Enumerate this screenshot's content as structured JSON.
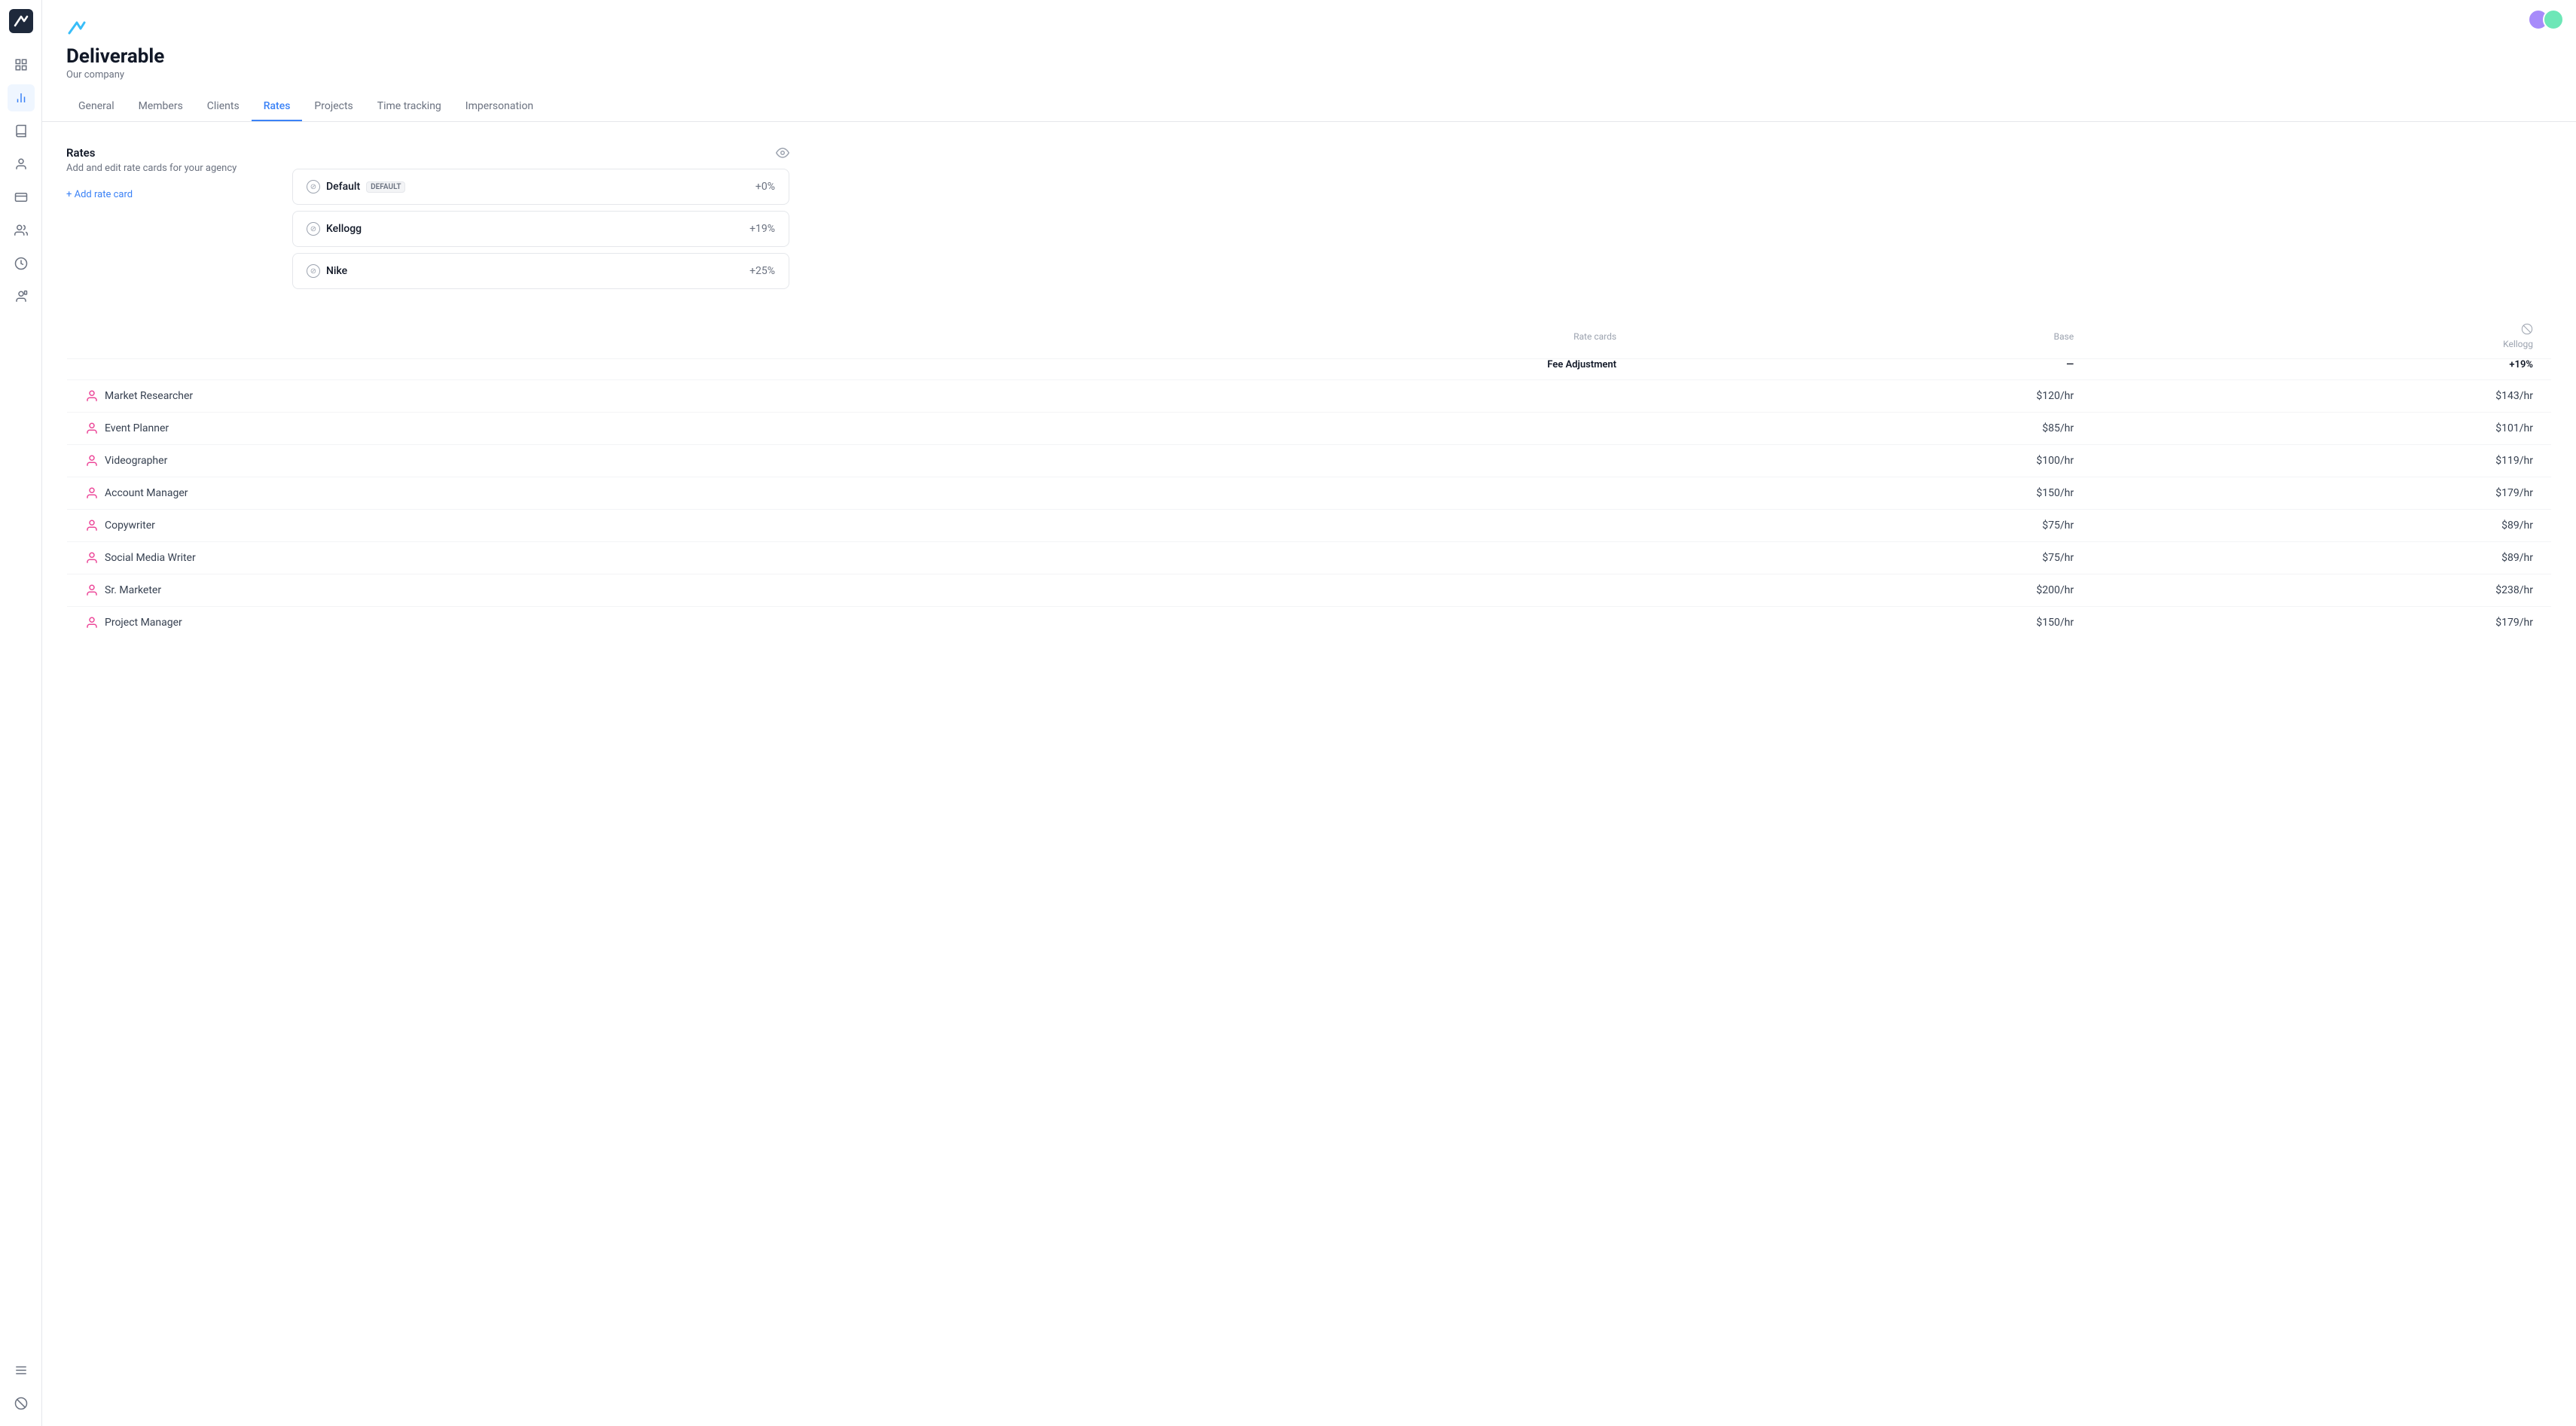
{
  "app": {
    "title": "Deliverable",
    "subtitle": "Our company"
  },
  "tabs": [
    {
      "id": "general",
      "label": "General"
    },
    {
      "id": "members",
      "label": "Members"
    },
    {
      "id": "clients",
      "label": "Clients"
    },
    {
      "id": "rates",
      "label": "Rates",
      "active": true
    },
    {
      "id": "projects",
      "label": "Projects"
    },
    {
      "id": "time-tracking",
      "label": "Time tracking"
    },
    {
      "id": "impersonation",
      "label": "Impersonation"
    }
  ],
  "rates_section": {
    "title": "Rates",
    "description": "Add and edit rate cards for your agency",
    "add_label": "+ Add rate card"
  },
  "rate_cards": [
    {
      "name": "Default",
      "badge": "DEFAULT",
      "pct": "+0%"
    },
    {
      "name": "Kellogg",
      "badge": null,
      "pct": "+19%"
    },
    {
      "name": "Nike",
      "badge": null,
      "pct": "+25%"
    }
  ],
  "table": {
    "col_rate_cards": "Rate cards",
    "col_fee": "Fee Adjustment",
    "col_base": "Base",
    "col_base_dash": "—",
    "col_kellogg": "Kellogg",
    "col_kellogg_pct": "+19%",
    "rows": [
      {
        "role": "Market Researcher",
        "base": "$120/hr",
        "kellogg": "$143/hr"
      },
      {
        "role": "Event Planner",
        "base": "$85/hr",
        "kellogg": "$101/hr"
      },
      {
        "role": "Videographer",
        "base": "$100/hr",
        "kellogg": "$119/hr"
      },
      {
        "role": "Account Manager",
        "base": "$150/hr",
        "kellogg": "$179/hr"
      },
      {
        "role": "Copywriter",
        "base": "$75/hr",
        "kellogg": "$89/hr"
      },
      {
        "role": "Social Media Writer",
        "base": "$75/hr",
        "kellogg": "$89/hr"
      },
      {
        "role": "Sr. Marketer",
        "base": "$200/hr",
        "kellogg": "$238/hr"
      },
      {
        "role": "Project Manager",
        "base": "$150/hr",
        "kellogg": "$179/hr"
      }
    ]
  },
  "sidebar": {
    "icons": [
      "grid",
      "chart",
      "book",
      "user",
      "invoice",
      "people",
      "clock",
      "contact"
    ]
  }
}
